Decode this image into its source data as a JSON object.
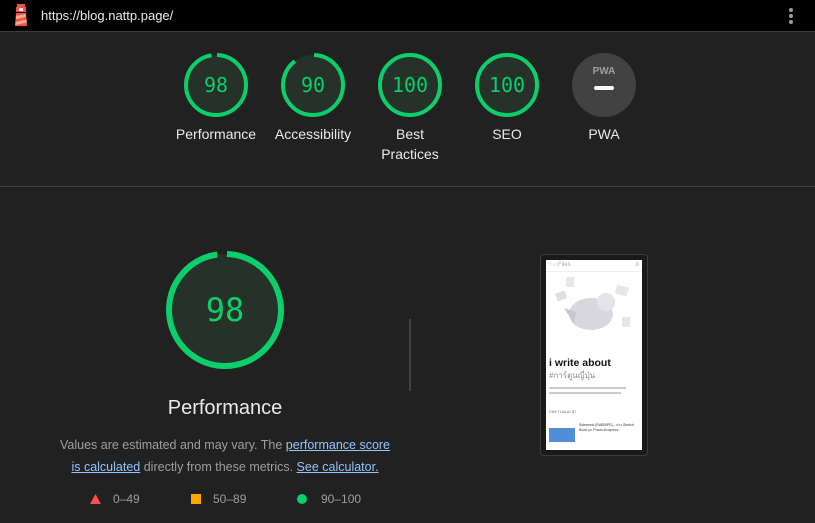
{
  "topbar": {
    "url": "https://blog.nattp.page/",
    "logo_icon": "lighthouse-icon",
    "menu_icon": "more-vert-icon"
  },
  "categories": [
    {
      "name": "Performance",
      "score": 98,
      "label": "Performance"
    },
    {
      "name": "Accessibility",
      "score": 90,
      "label": "Accessibility"
    },
    {
      "name": "Best Practices",
      "score": 100,
      "label_line1": "Best",
      "label_line2": "Practices"
    },
    {
      "name": "SEO",
      "score": 100,
      "label": "SEO"
    },
    {
      "name": "PWA",
      "score": null,
      "badge": "PWA",
      "label": "PWA"
    }
  ],
  "main": {
    "score": 98,
    "title": "Performance",
    "description": {
      "text1": "Values are estimated and may vary. The ",
      "link1": "performance score is calculated",
      "text2": " directly from these metrics. ",
      "link2": "See calculator."
    },
    "legend": [
      {
        "range": "0–49",
        "shape": "triangle",
        "color": "#ff4e42"
      },
      {
        "range": "50–89",
        "shape": "square",
        "color": "#ffa400"
      },
      {
        "range": "90–100",
        "shape": "circle",
        "color": "#0cce6b"
      }
    ]
  },
  "screenshot": {
    "site_name": "nat",
    "site_name_rest": "Files",
    "headline": "i write about",
    "hashtag": "#การ์ตูนญี่ปุ่น",
    "post_title": "Sideworld [RABBIPS] – ผ่าง Sketch Book แก Prado ดังเทุเพลง",
    "section": "บทความแนะนำ"
  },
  "colors": {
    "pass": "#0cce6b",
    "pass_bg": "#253129",
    "pwa_bg": "#424242"
  }
}
